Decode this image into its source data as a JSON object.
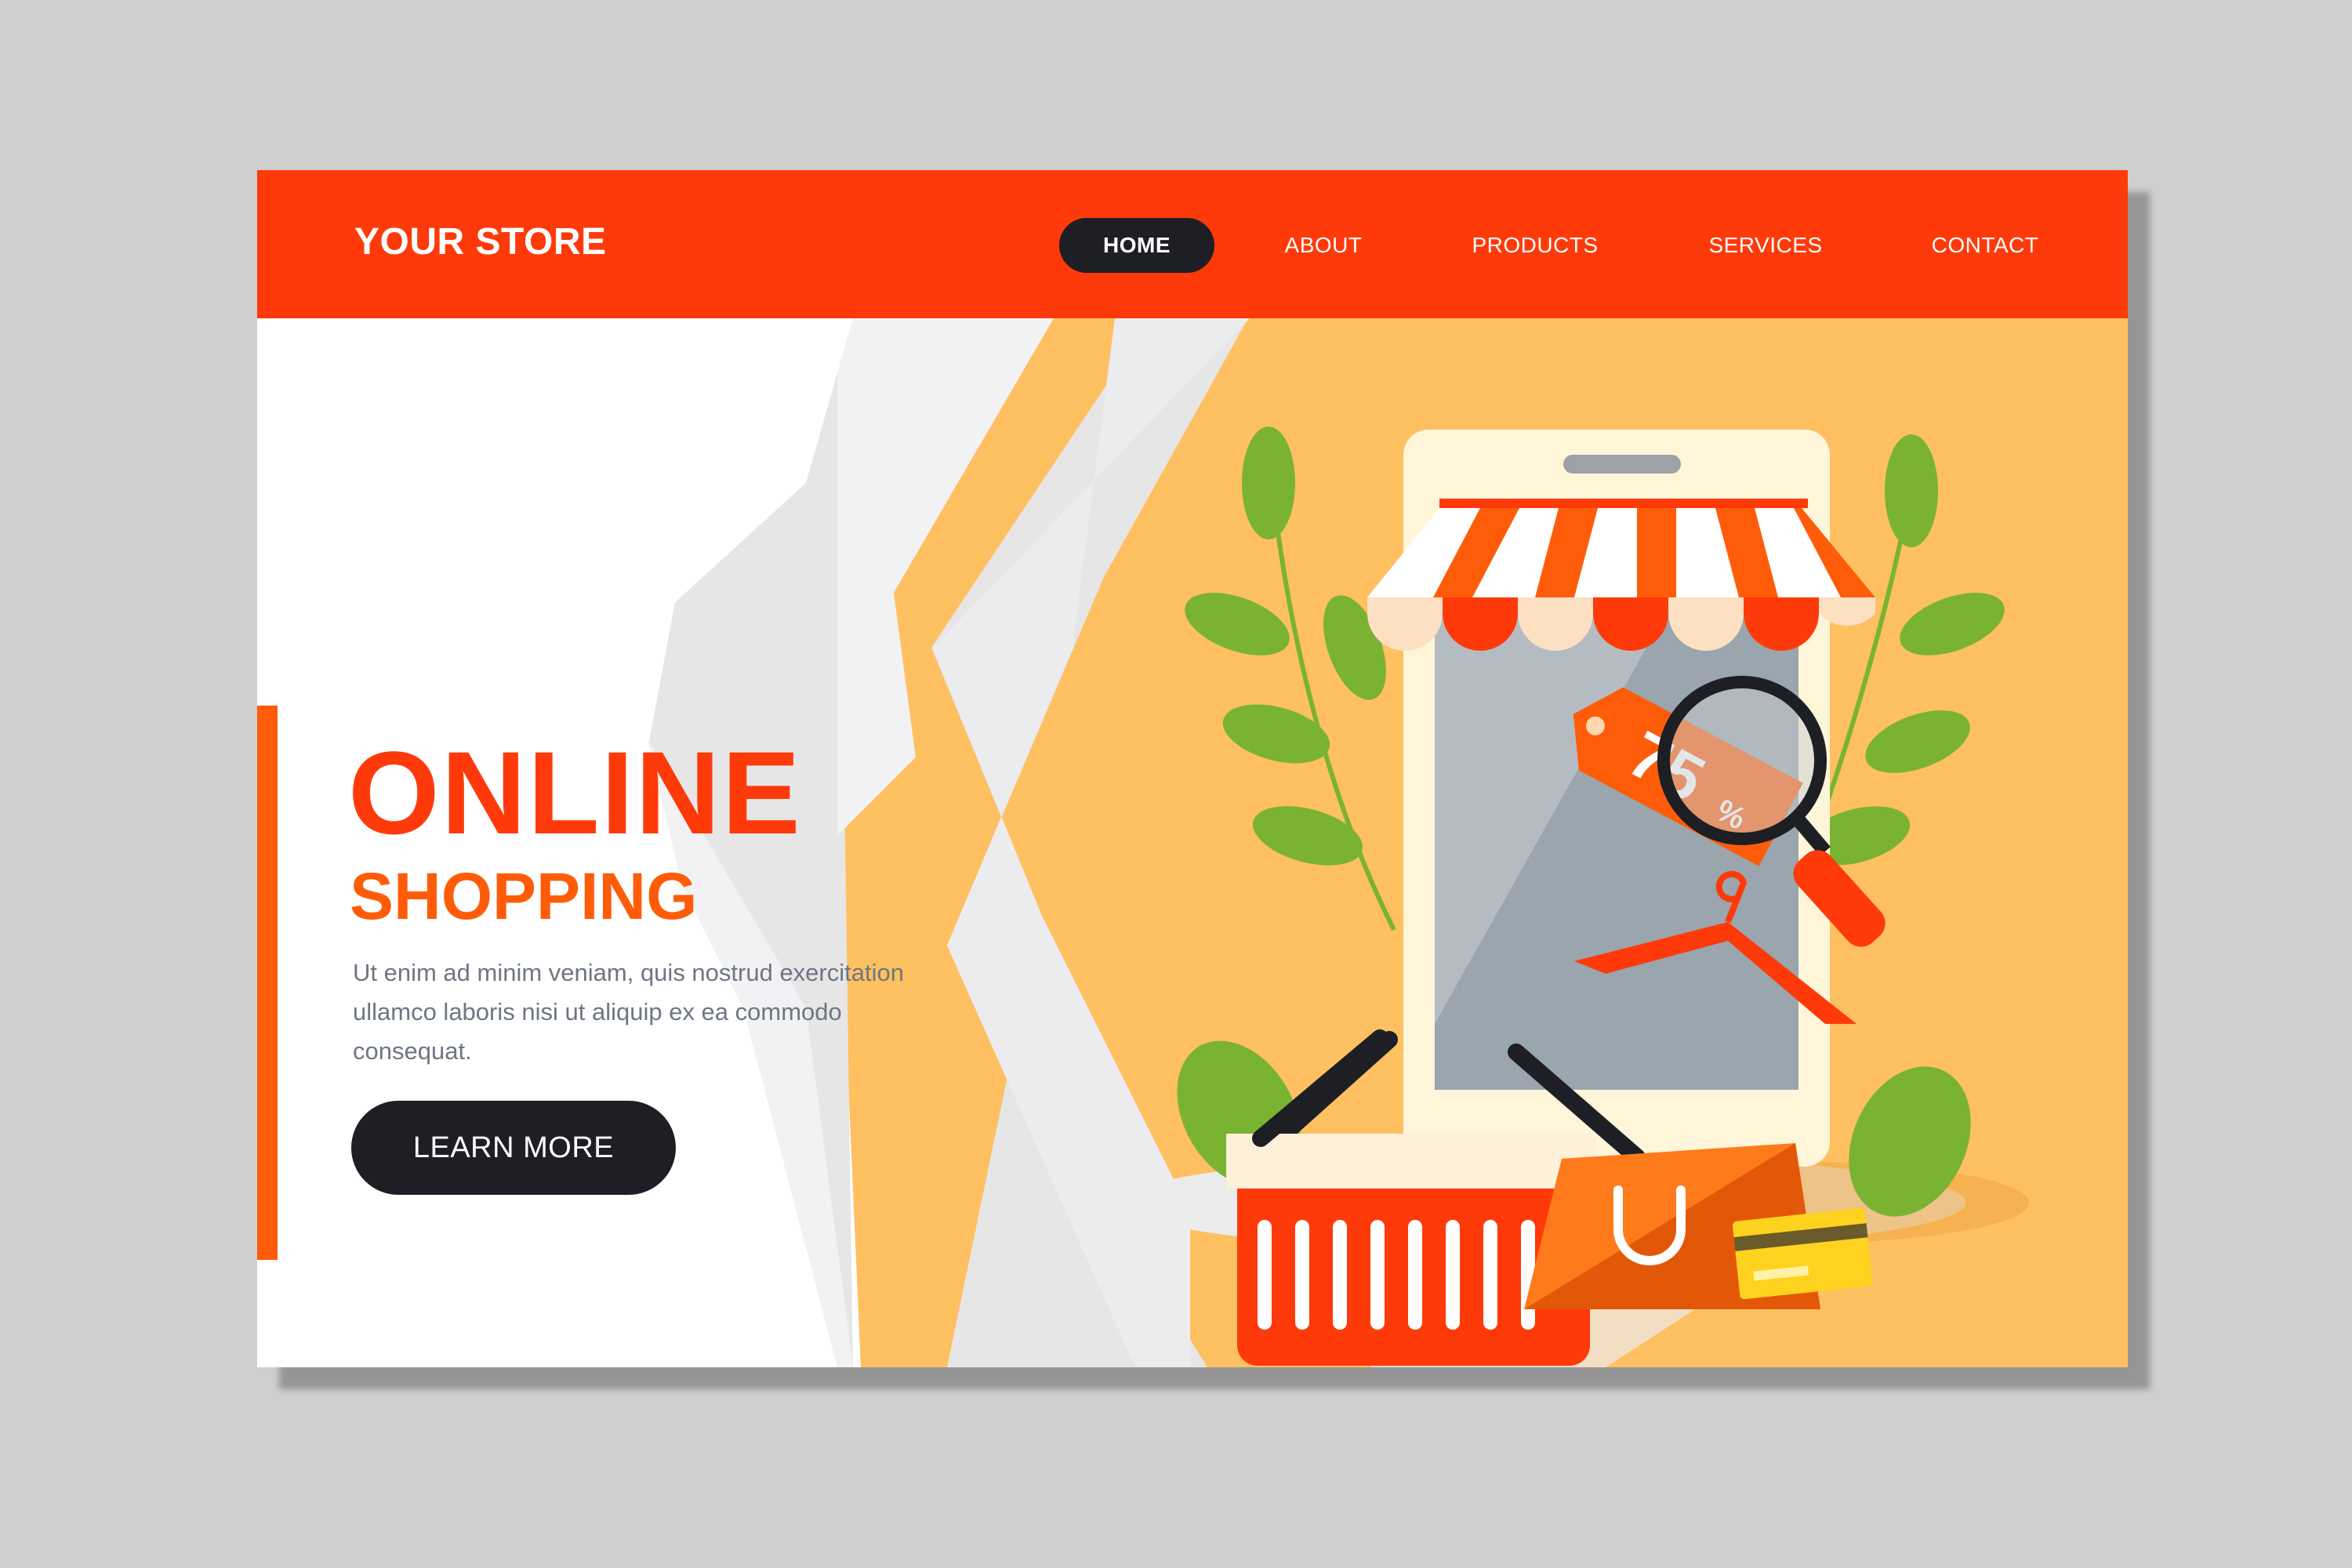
{
  "header": {
    "brand": "YOUR STORE",
    "nav": [
      {
        "label": "HOME",
        "active": true
      },
      {
        "label": "ABOUT",
        "active": false
      },
      {
        "label": "PRODUCTS",
        "active": false
      },
      {
        "label": "SERVICES",
        "active": false
      },
      {
        "label": "CONTACT",
        "active": false
      }
    ]
  },
  "hero": {
    "title": "ONLINE",
    "subtitle": "SHOPPING",
    "body": "Ut enim ad minim veniam, quis nostrud exercitation ullamco laboris nisi ut aliquip ex ea commodo consequat.",
    "cta_label": "LEARN MORE"
  },
  "illustration": {
    "discount_tag": {
      "value": "75",
      "unit": "%"
    },
    "items": [
      "phone-storefront",
      "awning",
      "price-tag",
      "magnifier-icon",
      "hanger",
      "shopping-basket",
      "shopping-bag",
      "credit-card",
      "plant-leaves"
    ]
  },
  "colors": {
    "primary": "#ff3a0a",
    "accent_orange": "#ff5c0a",
    "background_yellow": "#ffc061",
    "dark": "#1d1f24",
    "muted_text": "#6f7682",
    "leaf_green": "#7ab332"
  }
}
